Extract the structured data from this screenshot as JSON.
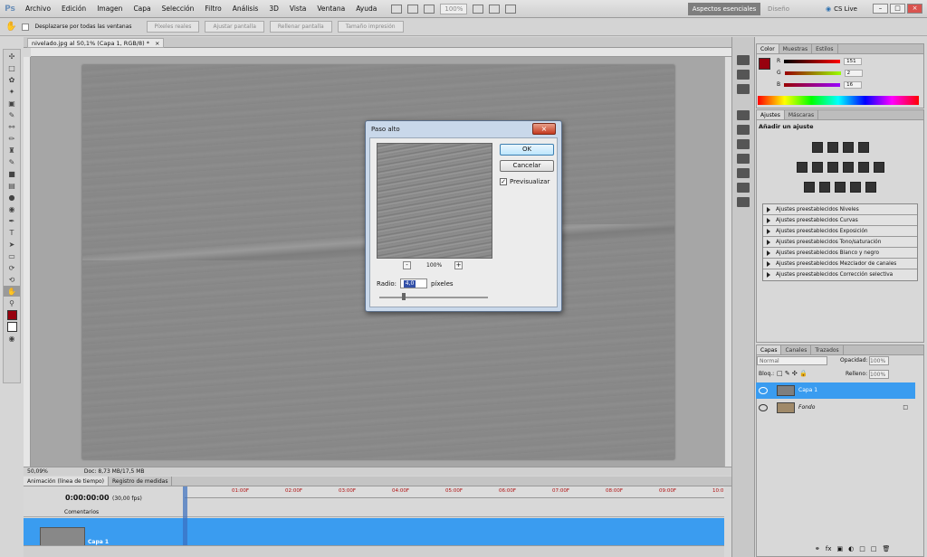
{
  "app": {
    "logo": "Ps"
  },
  "menu": [
    "Archivo",
    "Edición",
    "Imagen",
    "Capa",
    "Selección",
    "Filtro",
    "Análisis",
    "3D",
    "Vista",
    "Ventana",
    "Ayuda"
  ],
  "appbar": {
    "zoom": "100%",
    "workspace_active": "Aspectos esenciales",
    "workspace_other": "Diseño",
    "cslive": "CS Live"
  },
  "options": {
    "scroll_all": "Desplazarse por todas las ventanas",
    "actual_pixels": "Píxeles reales",
    "fit_screen": "Ajustar pantalla",
    "fill_screen": "Rellenar pantalla",
    "print_size": "Tamaño impresión"
  },
  "document": {
    "tab_title": "nivelado.jpg al 50,1% (Capa 1, RGB/8) *",
    "zoom": "50,09%",
    "doc_size": "Doc: 8,73 MB/17,5 MB"
  },
  "animation": {
    "tabs": [
      "Animación (línea de tiempo)",
      "Registro de medidas"
    ],
    "timecode": "0:00:00:00",
    "fps": "(30,00 fps)",
    "ticks": [
      "01:00F",
      "02:00F",
      "03:00F",
      "04:00F",
      "05:00F",
      "06:00F",
      "07:00F",
      "08:00F",
      "09:00F",
      "10:0"
    ],
    "comments": "Comentarios",
    "layer": "Capa 1"
  },
  "color_panel": {
    "tabs": [
      "Color",
      "Muestras",
      "Estilos"
    ],
    "channels": [
      {
        "label": "R",
        "value": "151",
        "color": "#c01818"
      },
      {
        "label": "G",
        "value": "2",
        "color": "#18a018"
      },
      {
        "label": "B",
        "value": "16",
        "color": "#1818c0"
      }
    ],
    "fg_color": "#97020f"
  },
  "adjust_panel": {
    "tabs": [
      "Ajustes",
      "Máscaras"
    ],
    "heading": "Añadir un ajuste",
    "presets": [
      "Ajustes preestablecidos Niveles",
      "Ajustes preestablecidos Curvas",
      "Ajustes preestablecidos Exposición",
      "Ajustes preestablecidos Tono/saturación",
      "Ajustes preestablecidos Blanco y negro",
      "Ajustes preestablecidos Mezclador de canales",
      "Ajustes preestablecidos Corrección selectiva"
    ]
  },
  "layers_panel": {
    "tabs": [
      "Capas",
      "Canales",
      "Trazados"
    ],
    "blend_mode": "Normal",
    "opacity_label": "Opacidad:",
    "opacity": "100%",
    "lock_label": "Bloq.:",
    "fill_label": "Relleno:",
    "fill": "100%",
    "layers": [
      {
        "name": "Capa 1",
        "selected": true
      },
      {
        "name": "Fondo",
        "selected": false
      }
    ]
  },
  "dialog": {
    "title": "Paso alto",
    "ok": "OK",
    "cancel": "Cancelar",
    "preview_label": "Previsualizar",
    "preview_checked": true,
    "zoom": "100%",
    "radius_label": "Radio:",
    "radius_value": "4,0",
    "radius_unit": "píxeles"
  }
}
